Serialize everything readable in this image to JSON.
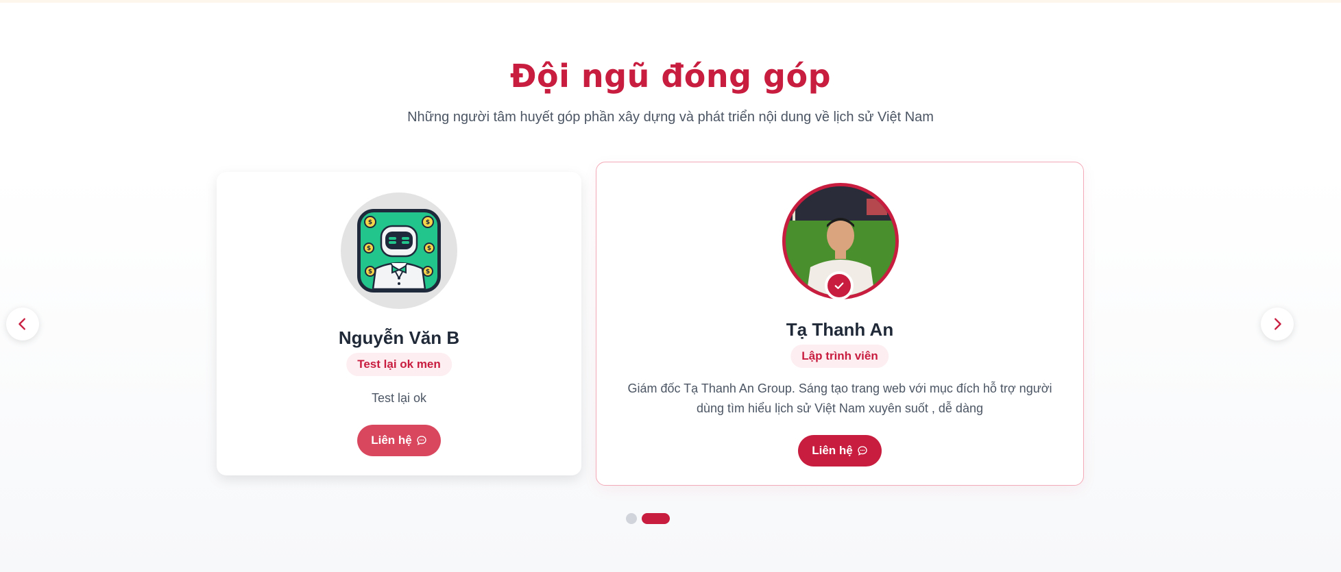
{
  "section": {
    "title": "Đội ngũ đóng góp",
    "subtitle": "Những người tâm huyết góp phần xây dựng và phát triển nội dung về lịch sử Việt Nam"
  },
  "colors": {
    "accent": "#c81d3f",
    "accent_soft": "#fdeef1",
    "text_dark": "#1f2937",
    "text_muted": "#4b5563"
  },
  "carousel": {
    "prev_icon": "chevron-left-icon",
    "next_icon": "chevron-right-icon",
    "active_index": 1,
    "dot_count": 2
  },
  "members": [
    {
      "name": "Nguyễn Văn B",
      "role": "Test lại ok men",
      "description": "Test lại ok",
      "contact_label": "Liên hệ",
      "contact_icon": "chat-bubble-icon",
      "avatar": "robot-avatar"
    },
    {
      "name": "Tạ Thanh An",
      "role": "Lập trình viên",
      "description": "Giám đốc Tạ Thanh An Group. Sáng tạo trang web với mục đích hỗ trợ người dùng tìm hiểu lịch sử Việt Nam xuyên suốt , dễ dàng",
      "contact_label": "Liên hệ",
      "contact_icon": "chat-bubble-icon",
      "avatar": "photo-avatar",
      "verified": true
    }
  ]
}
